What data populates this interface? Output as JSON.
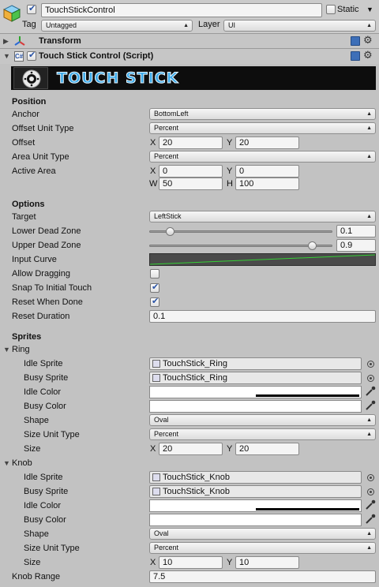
{
  "header": {
    "object_name": "TouchStickControl",
    "static_label": "Static",
    "tag_label": "Tag",
    "tag_value": "Untagged",
    "layer_label": "Layer",
    "layer_value": "UI"
  },
  "components": {
    "transform": "Transform",
    "script": "Touch Stick Control (Script)"
  },
  "banner": {
    "text": "TOUCH STICK"
  },
  "position": {
    "section": "Position",
    "anchor_label": "Anchor",
    "anchor_value": "BottomLeft",
    "offset_unit_label": "Offset Unit Type",
    "offset_unit_value": "Percent",
    "offset_label": "Offset",
    "offset_x": "20",
    "offset_y": "20",
    "area_unit_label": "Area Unit Type",
    "area_unit_value": "Percent",
    "active_area_label": "Active Area",
    "area_x": "0",
    "area_y": "0",
    "area_w": "50",
    "area_h": "100"
  },
  "axis": {
    "x": "X",
    "y": "Y",
    "w": "W",
    "h": "H"
  },
  "options": {
    "section": "Options",
    "target_label": "Target",
    "target_value": "LeftStick",
    "lower_dead_label": "Lower Dead Zone",
    "lower_dead_value": "0.1",
    "upper_dead_label": "Upper Dead Zone",
    "upper_dead_value": "0.9",
    "input_curve_label": "Input Curve",
    "allow_dragging_label": "Allow Dragging",
    "snap_label": "Snap To Initial Touch",
    "reset_label": "Reset When Done",
    "reset_duration_label": "Reset Duration",
    "reset_duration_value": "0.1"
  },
  "sprites": {
    "section": "Sprites",
    "ring": {
      "label": "Ring",
      "idle_sprite_label": "Idle Sprite",
      "idle_sprite_value": "TouchStick_Ring",
      "busy_sprite_label": "Busy Sprite",
      "busy_sprite_value": "TouchStick_Ring",
      "idle_color_label": "Idle Color",
      "busy_color_label": "Busy Color",
      "shape_label": "Shape",
      "shape_value": "Oval",
      "size_unit_label": "Size Unit Type",
      "size_unit_value": "Percent",
      "size_label": "Size",
      "size_x": "20",
      "size_y": "20"
    },
    "knob": {
      "label": "Knob",
      "idle_sprite_label": "Idle Sprite",
      "idle_sprite_value": "TouchStick_Knob",
      "busy_sprite_label": "Busy Sprite",
      "busy_sprite_value": "TouchStick_Knob",
      "idle_color_label": "Idle Color",
      "busy_color_label": "Busy Color",
      "shape_label": "Shape",
      "shape_value": "Oval",
      "size_unit_label": "Size Unit Type",
      "size_unit_value": "Percent",
      "size_label": "Size",
      "size_x": "10",
      "size_y": "10"
    },
    "knob_range_label": "Knob Range",
    "knob_range_value": "7.5"
  },
  "state": {
    "allow_dragging": false,
    "snap_to_initial_touch": true,
    "reset_when_done": true,
    "object_enabled": true,
    "script_enabled": true,
    "lower_dead_fraction": 0.1,
    "upper_dead_fraction": 0.9
  },
  "colors": {
    "banner_bg": "#0d0d0d",
    "banner_text": "#3aa9e8",
    "curve_bg": "#4a4a4a",
    "curve_line": "#35d135",
    "inspector_bg": "#c2c2c2"
  }
}
